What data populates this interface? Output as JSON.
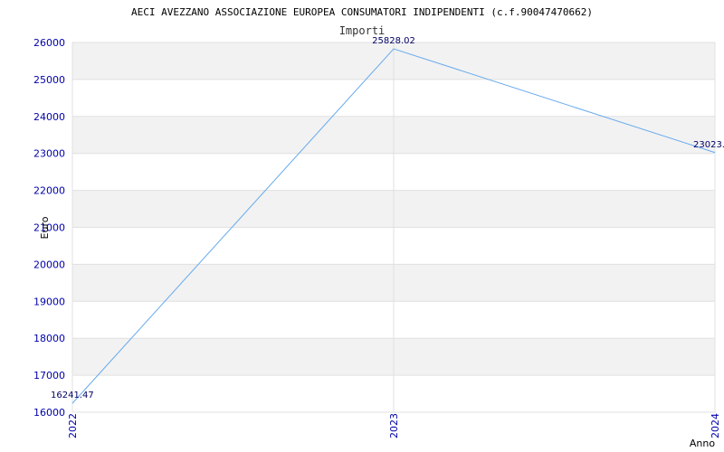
{
  "chart_data": {
    "type": "line",
    "title": "AECI AVEZZANO ASSOCIAZIONE EUROPEA CONSUMATORI INDIPENDENTI (c.f.90047470662)",
    "subtitle": "Importi",
    "xlabel": "Anno",
    "ylabel": "Euro",
    "categories": [
      "2022",
      "2023",
      "2024"
    ],
    "series": [
      {
        "values": [
          16241.47,
          25828.02,
          23023.0
        ]
      }
    ],
    "data_labels": [
      "16241.47",
      "25828.02",
      "23023."
    ],
    "ylim": [
      16000,
      26000
    ],
    "yticks": [
      16000,
      17000,
      18000,
      19000,
      20000,
      21000,
      22000,
      23000,
      24000,
      25000,
      26000
    ],
    "grid": true,
    "band_color": "#f2f2f2",
    "line_color": "#66aaee",
    "tick_color": "#0000aa"
  }
}
